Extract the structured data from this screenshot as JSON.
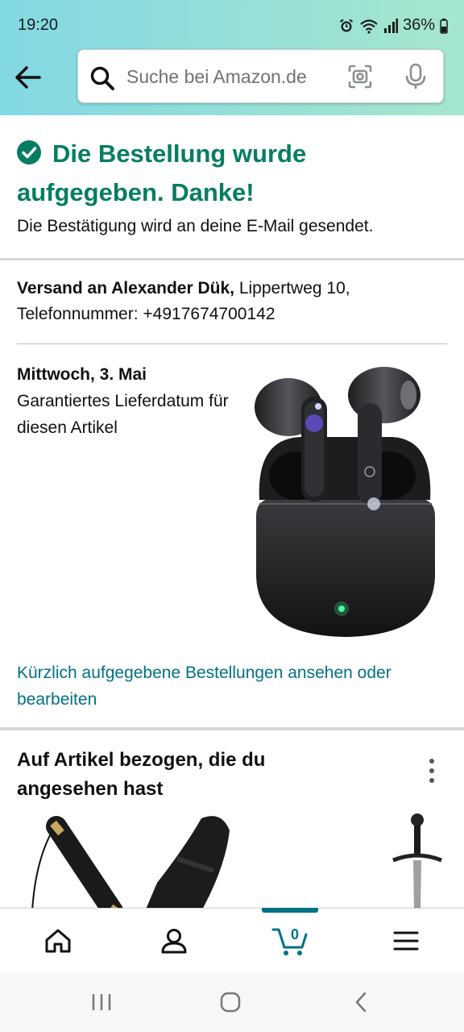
{
  "status_bar": {
    "time": "19:20",
    "battery": "36%"
  },
  "header": {
    "search_placeholder": "Suche bei Amazon.de"
  },
  "confirmation": {
    "title": "Die Bestellung wurde aufgegeben. Danke!",
    "subtitle": "Die Bestätigung wird an deine E-Mail gesendet."
  },
  "shipping": {
    "label": "Versand an Alexander Dük,",
    "address": " Lippertweg 10, Telefonnummer: +4917674700142"
  },
  "delivery": {
    "date": "Mittwoch, 3. Mai",
    "note": "Garantiertes Lieferdatum für diesen Artikel"
  },
  "orders_link": "Kürzlich aufgegebene Bestellungen ansehen oder bearbeiten",
  "related": {
    "title": "Auf Artikel bezogen, die du angesehen hast"
  },
  "bottom_nav": {
    "cart_count": "0",
    "items": [
      "home-icon",
      "account-icon",
      "cart-icon",
      "menu-icon"
    ]
  },
  "colors": {
    "accent_teal": "#007185",
    "success_green": "#067d62",
    "header_gradient_start": "#82d8e3",
    "header_gradient_end": "#a6e6ce"
  }
}
